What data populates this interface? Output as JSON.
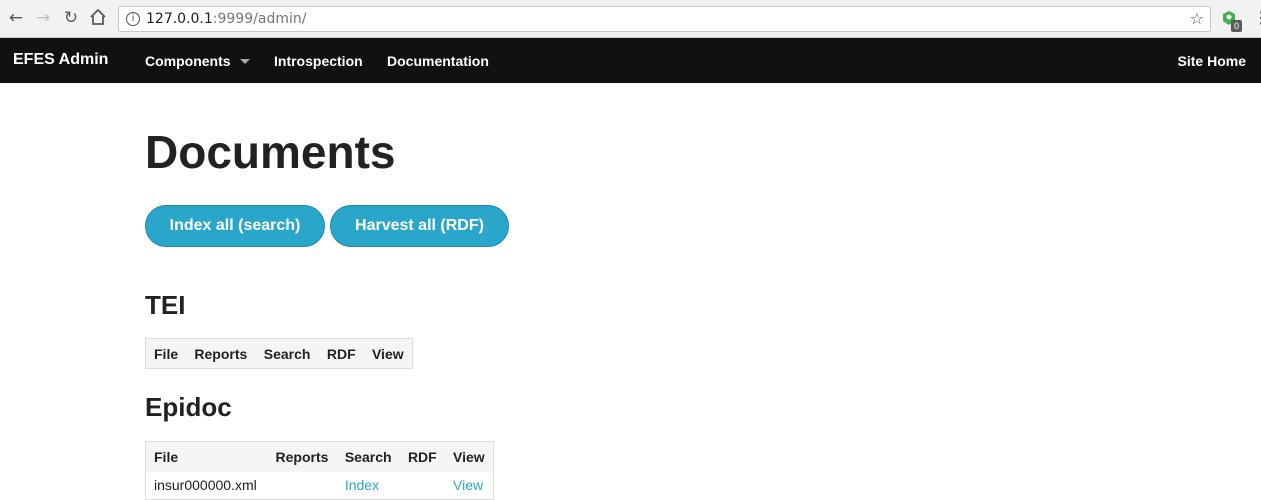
{
  "browser": {
    "url_host": "127.0.0.1",
    "url_rest": ":9999/admin/",
    "extension_badge": "0"
  },
  "navbar": {
    "brand": "EFES Admin",
    "items": [
      {
        "label": "Components"
      },
      {
        "label": "Introspection"
      },
      {
        "label": "Documentation"
      }
    ],
    "site_home": "Site Home"
  },
  "main": {
    "title": "Documents",
    "buttons": {
      "index_all": "Index all (search)",
      "harvest_all": "Harvest all (RDF)"
    },
    "tei": {
      "title": "TEI",
      "columns": [
        "File",
        "Reports",
        "Search",
        "RDF",
        "View"
      ]
    },
    "epidoc": {
      "title": "Epidoc",
      "columns": [
        "File",
        "Reports",
        "Search",
        "RDF",
        "View"
      ],
      "rows": [
        {
          "file": "insur000000.xml",
          "search": "Index",
          "view": "View"
        }
      ]
    }
  },
  "colors": {
    "navbar_bg": "#111111",
    "button_bg": "#2ba6cb",
    "link": "#2ba6cb"
  }
}
